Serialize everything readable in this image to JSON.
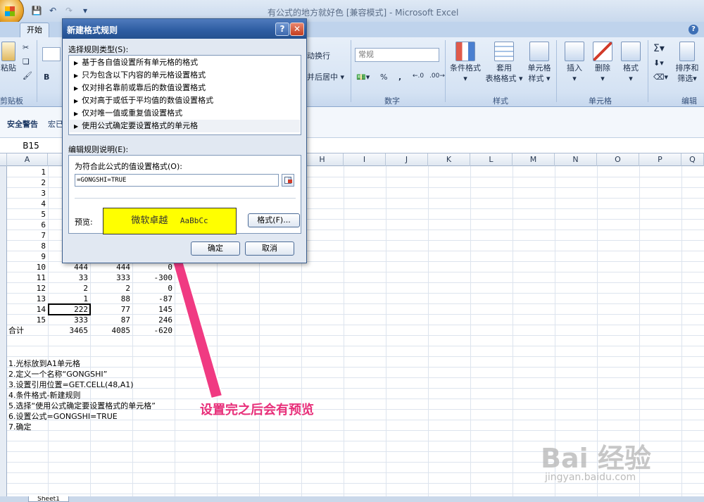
{
  "window": {
    "title": "有公式的地方就好色  [兼容模式]  -  Microsoft Excel"
  },
  "quick_access": {
    "icons": [
      "save-icon",
      "undo-icon",
      "redo-icon",
      "customize-icon"
    ]
  },
  "ribbon": {
    "active_tab": "开始",
    "clipboard": {
      "paste_label": "粘贴",
      "group_label": "剪贴板"
    },
    "alignment": {
      "wrap_label": "动换行",
      "merge_label": "并后居中"
    },
    "number": {
      "format_value": "常规",
      "group_label": "数字",
      "percent": "%",
      "comma": ","
    },
    "styles": {
      "conditional_label_1": "条件格式",
      "table_label_1": "套用",
      "table_label_2": "表格格式",
      "cell_style_label_1": "单元格",
      "cell_style_label_2": "样式",
      "group_label": "样式"
    },
    "cells": {
      "insert_label": "插入",
      "delete_label": "删除",
      "format_label": "格式",
      "group_label": "单元格"
    },
    "editing": {
      "sort_label_1": "排序和",
      "sort_label_2": "筛选",
      "group_label": "编辑"
    }
  },
  "security_bar": {
    "label": "安全警告",
    "macro_text": "宏已"
  },
  "formula_bar": {
    "name_box": "B15"
  },
  "grid": {
    "columns": [
      "A",
      "H",
      "I",
      "J",
      "K",
      "L",
      "M",
      "N",
      "O",
      "P",
      "Q"
    ],
    "row_numbers": [
      "1",
      "2",
      "3",
      "4",
      "5",
      "6",
      "7",
      "8",
      "9",
      "10",
      "11",
      "12",
      "13",
      "14",
      "15"
    ],
    "visible_rows": [
      {
        "a": "10",
        "b": "444",
        "c": "444",
        "d": "0"
      },
      {
        "a": "11",
        "b": "33",
        "c": "333",
        "d": "-300"
      },
      {
        "a": "12",
        "b": "2",
        "c": "2",
        "d": "0"
      },
      {
        "a": "13",
        "b": "1",
        "c": "88",
        "d": "-87"
      },
      {
        "a": "14",
        "b": "222",
        "c": "77",
        "d": "145"
      },
      {
        "a": "15",
        "b": "333",
        "c": "87",
        "d": "246"
      }
    ],
    "total_row": {
      "a": "合计",
      "b": "3465",
      "c": "4085",
      "d": "-620"
    },
    "notes": [
      "1.光标放到A1单元格",
      "2.定义一个名称“GONGSHI”",
      "3.设置引用位置=GET.CELL(48,A1)",
      "4.条件格式-新建规则",
      "5.选择“使用公式确定要设置格式的单元格”",
      "6.设置公式=GONGSHI=TRUE",
      "7.确定"
    ]
  },
  "sheet_tabs": {
    "sheet1": "Sheet1"
  },
  "dialog": {
    "title": "新建格式规则",
    "rule_type_label": "选择规则类型(S):",
    "rule_types": [
      "基于各自值设置所有单元格的格式",
      "只为包含以下内容的单元格设置格式",
      "仅对排名靠前或靠后的数值设置格式",
      "仅对高于或低于平均值的数值设置格式",
      "仅对唯一值或重复值设置格式",
      "使用公式确定要设置格式的单元格"
    ],
    "selected_index": 5,
    "edit_label": "编辑规则说明(E):",
    "formula_label": "为符合此公式的值设置格式(O):",
    "formula_value": "=GONGSHI=TRUE",
    "preview_label": "预览:",
    "preview_cn": "微软卓越",
    "preview_en": "AaBbCc",
    "preview_bg": "#ffff00",
    "format_button": "格式(F)...",
    "ok_button": "确定",
    "cancel_button": "取消"
  },
  "annotation": {
    "text": "设置完之后会有预览",
    "color": "#e8307a"
  },
  "watermark": {
    "main": "Bai 经验",
    "sub": "jingyan.baidu.com"
  }
}
